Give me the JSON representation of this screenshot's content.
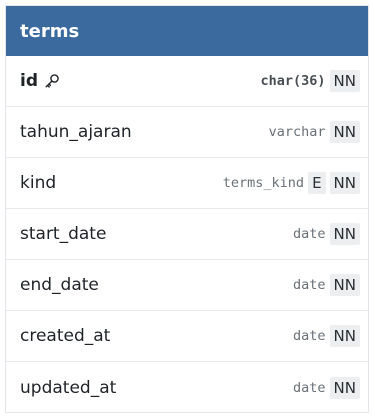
{
  "table": {
    "name": "terms",
    "columns": [
      {
        "name": "id",
        "type": "char(36)",
        "pk": true,
        "enum": false,
        "nn": "NN"
      },
      {
        "name": "tahun_ajaran",
        "type": "varchar",
        "pk": false,
        "enum": false,
        "nn": "NN"
      },
      {
        "name": "kind",
        "type": "terms_kind",
        "pk": false,
        "enum": true,
        "enum_label": "E",
        "nn": "NN"
      },
      {
        "name": "start_date",
        "type": "date",
        "pk": false,
        "enum": false,
        "nn": "NN"
      },
      {
        "name": "end_date",
        "type": "date",
        "pk": false,
        "enum": false,
        "nn": "NN"
      },
      {
        "name": "created_at",
        "type": "date",
        "pk": false,
        "enum": false,
        "nn": "NN"
      },
      {
        "name": "updated_at",
        "type": "date",
        "pk": false,
        "enum": false,
        "nn": "NN"
      }
    ]
  },
  "colors": {
    "header_bg": "#3a6a9e",
    "header_text": "#ffffff",
    "badge_bg": "#eceef0"
  },
  "icons": {
    "primary_key": "key-icon"
  }
}
